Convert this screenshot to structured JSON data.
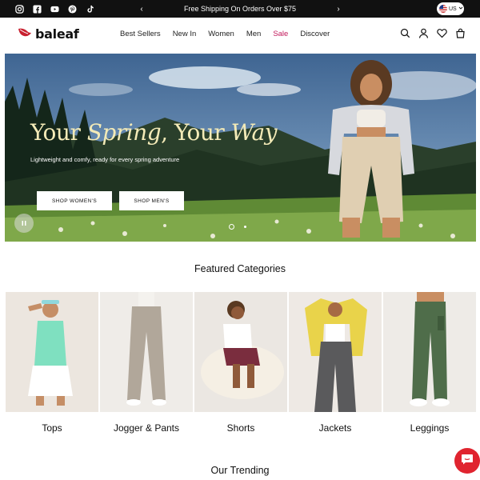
{
  "topbar": {
    "socials": [
      "instagram-icon",
      "facebook-icon",
      "youtube-icon",
      "pinterest-icon",
      "tiktok-icon"
    ],
    "announcement": "Free Shipping On Orders Over $75",
    "prev_arrow": "‹",
    "next_arrow": "›",
    "locale": "US"
  },
  "header": {
    "logo_text": "baleaf",
    "nav": [
      "Best Sellers",
      "New In",
      "Women",
      "Men",
      "Sale",
      "Discover"
    ],
    "icons": [
      "search-icon",
      "account-icon",
      "wishlist-icon",
      "cart-icon"
    ]
  },
  "hero": {
    "title_part1": "Your ",
    "title_italic1": "Spring",
    "title_part2": ", Your ",
    "title_italic2": "Way",
    "subtitle": "Lightweight and comfy, ready for every spring adventure",
    "btn_women": "SHOP WOMEN'S",
    "btn_men": "SHOP MEN'S",
    "slide_count": 2,
    "active_slide": 1
  },
  "featured": {
    "title": "Featured Categories",
    "categories": [
      {
        "label": "Tops"
      },
      {
        "label": "Jogger & Pants"
      },
      {
        "label": "Shorts"
      },
      {
        "label": "Jackets"
      },
      {
        "label": "Leggings"
      }
    ]
  },
  "trending": {
    "title": "Our Trending"
  },
  "colors": {
    "topbar_bg": "#111111",
    "sale": "#c2185b",
    "logo_red": "#c8202f",
    "hero_title": "#f3eab7",
    "chat": "#e0242f"
  }
}
